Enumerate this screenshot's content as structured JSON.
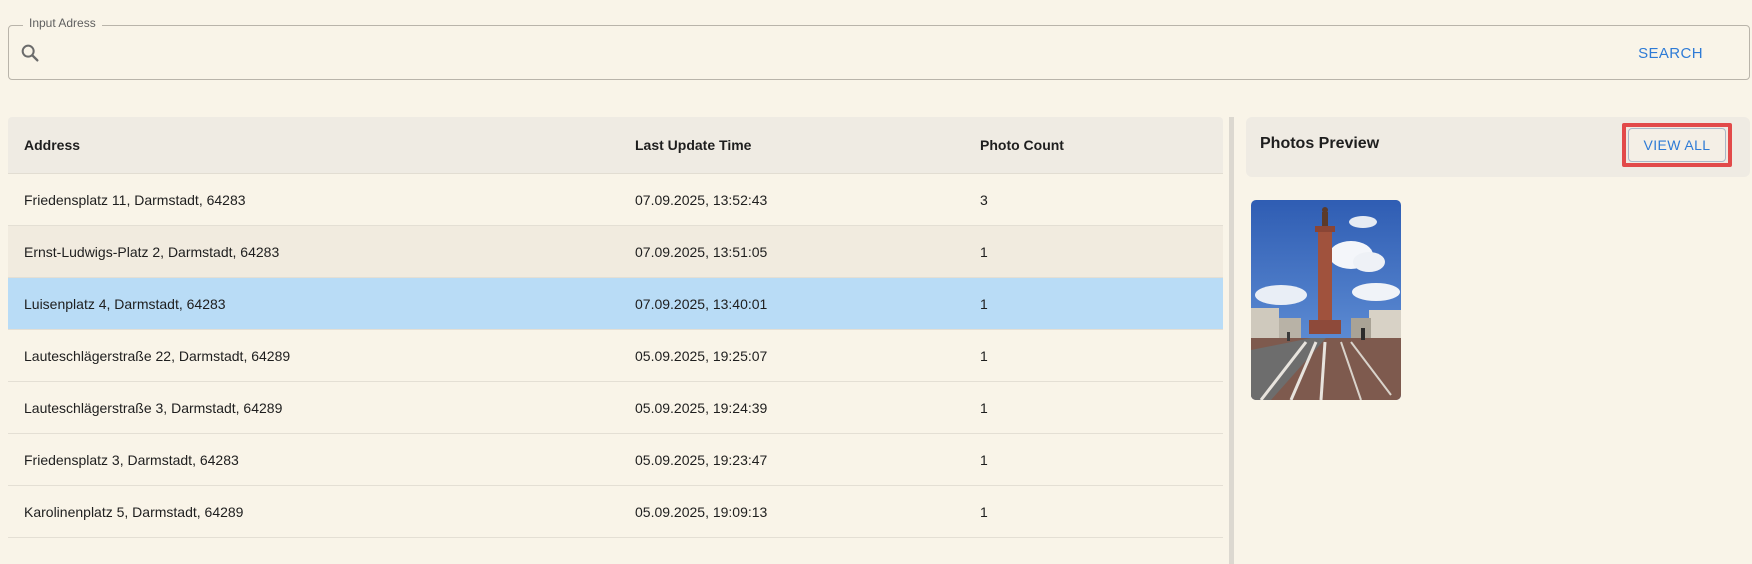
{
  "search": {
    "label": "Input Adress",
    "placeholder": "",
    "value": "",
    "button_label": "SEARCH"
  },
  "table": {
    "headers": {
      "address": "Address",
      "last_update": "Last Update Time",
      "photo_count": "Photo Count"
    },
    "rows": [
      {
        "address": "Friedensplatz 11, Darmstadt, 64283",
        "time": "07.09.2025, 13:52:43",
        "count": "3"
      },
      {
        "address": "Ernst-Ludwigs-Platz 2, Darmstadt, 64283",
        "time": "07.09.2025, 13:51:05",
        "count": "1"
      },
      {
        "address": "Luisenplatz 4, Darmstadt, 64283",
        "time": "07.09.2025, 13:40:01",
        "count": "1"
      },
      {
        "address": "Lauteschlägerstraße 22, Darmstadt, 64289",
        "time": "05.09.2025, 19:25:07",
        "count": "1"
      },
      {
        "address": "Lauteschlägerstraße 3, Darmstadt, 64289",
        "time": "05.09.2025, 19:24:39",
        "count": "1"
      },
      {
        "address": "Friedensplatz 3, Darmstadt, 64283",
        "time": "05.09.2025, 19:23:47",
        "count": "1"
      },
      {
        "address": "Karolinenplatz 5, Darmstadt, 64289",
        "time": "05.09.2025, 19:09:13",
        "count": "1"
      }
    ],
    "selected_index": 2,
    "hovered_index": 1
  },
  "preview": {
    "title": "Photos Preview",
    "view_all_label": "VIEW ALL"
  },
  "colors": {
    "background": "#f9f4e8",
    "header_bg": "#efebe3",
    "selected_row": "#b9dcf6",
    "accent": "#2e7bd6",
    "highlight": "#e24a4a"
  },
  "icons": {
    "search": "search-icon"
  }
}
